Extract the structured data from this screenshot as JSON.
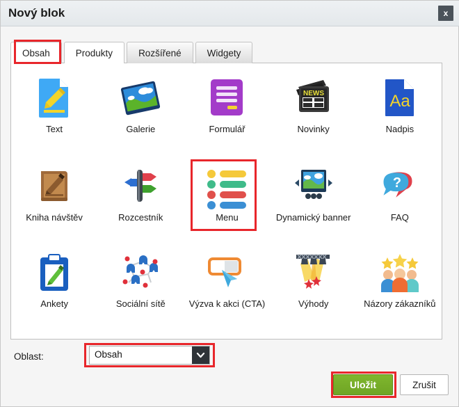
{
  "dialog": {
    "title": "Nový blok",
    "close_label": "x"
  },
  "tabs": [
    {
      "label": "Obsah",
      "active": true
    },
    {
      "label": "Produkty",
      "active": false
    },
    {
      "label": "Rozšířené",
      "active": false
    },
    {
      "label": "Widgety",
      "active": false
    }
  ],
  "blocks": [
    {
      "label": "Text",
      "icon": "document-pencil-icon"
    },
    {
      "label": "Galerie",
      "icon": "photo-gallery-icon"
    },
    {
      "label": "Formulář",
      "icon": "form-icon"
    },
    {
      "label": "Novinky",
      "icon": "news-icon"
    },
    {
      "label": "Nadpis",
      "icon": "heading-aa-icon"
    },
    {
      "label": "Kniha návštěv",
      "icon": "guestbook-icon"
    },
    {
      "label": "Rozcestník",
      "icon": "signpost-icon"
    },
    {
      "label": "Menu",
      "icon": "menu-list-icon"
    },
    {
      "label": "Dynamický banner",
      "icon": "dynamic-banner-icon"
    },
    {
      "label": "FAQ",
      "icon": "faq-speech-bubbles-icon"
    },
    {
      "label": "Ankety",
      "icon": "poll-clipboard-icon"
    },
    {
      "label": "Sociální sítě",
      "icon": "social-network-icon"
    },
    {
      "label": "Výzva k akci (CTA)",
      "icon": "cta-cursor-icon"
    },
    {
      "label": "Výhody",
      "icon": "spotlight-benefits-icon"
    },
    {
      "label": "Názory zákazníků",
      "icon": "customer-reviews-icon"
    }
  ],
  "footer": {
    "oblast_label": "Oblast:",
    "oblast_value": "Obsah",
    "save_label": "Uložit",
    "cancel_label": "Zrušit"
  },
  "highlights": {
    "accent_color": "#e8262b",
    "save_color": "#76ae28"
  }
}
